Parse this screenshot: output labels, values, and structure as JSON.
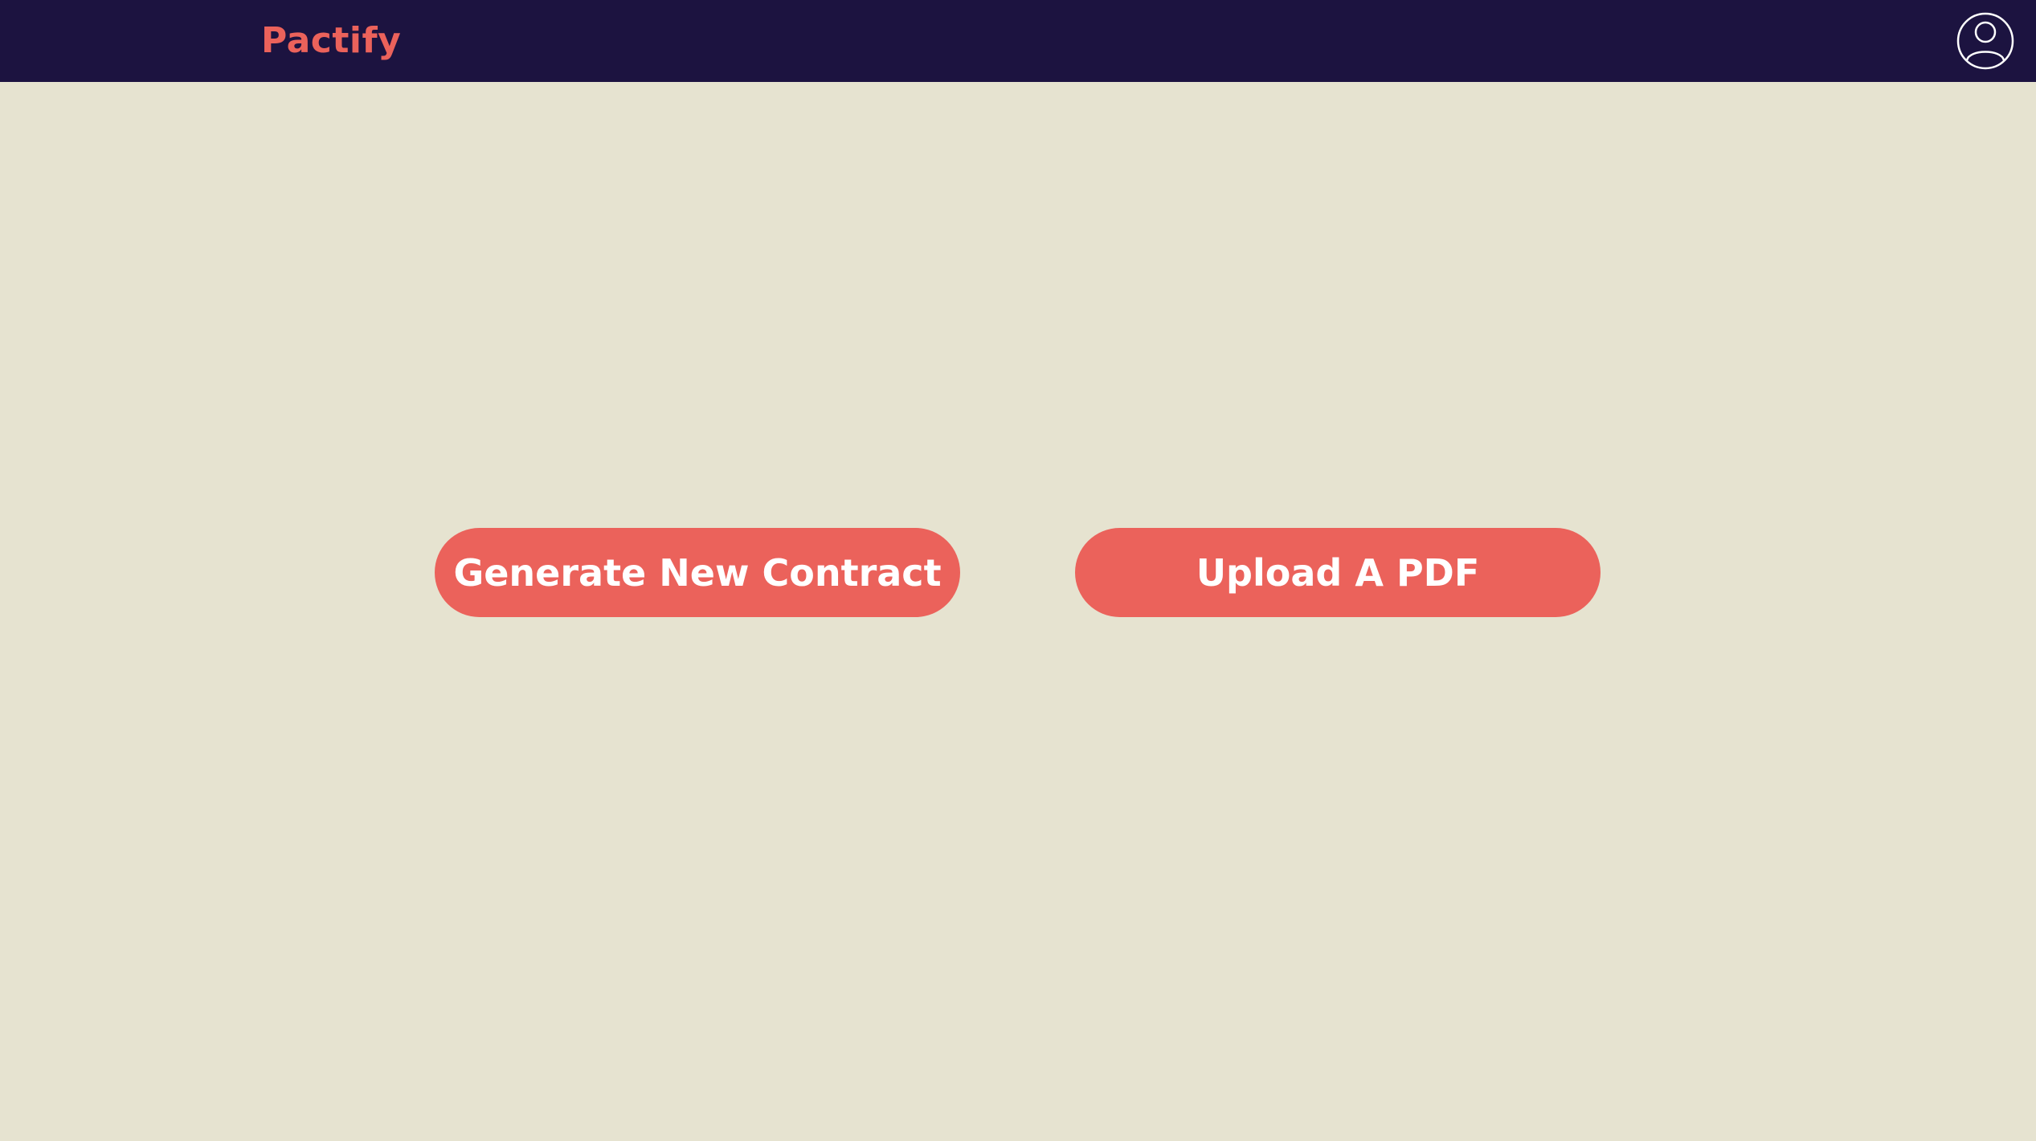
{
  "navbar": {
    "brand": "Pactify",
    "account_icon": "user-circle-icon"
  },
  "main": {
    "generate_label": "Generate New Contract",
    "upload_label": "Upload A PDF"
  },
  "colors": {
    "navbar_bg": "#1c1340",
    "page_bg": "#e6e3d0",
    "accent": "#eb625b",
    "button_text": "#ffffff"
  }
}
